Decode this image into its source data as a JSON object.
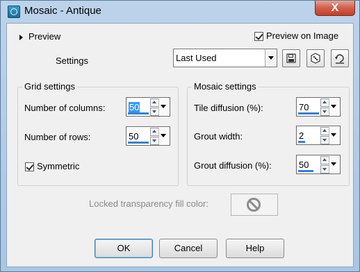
{
  "window": {
    "title": "Mosaic - Antique",
    "close_label": "X"
  },
  "preview": {
    "label": "Preview",
    "preview_on_image_label": "Preview on Image",
    "preview_on_image_checked": true
  },
  "settings": {
    "label": "Settings",
    "preset_value": "Last Used"
  },
  "grid_settings": {
    "title": "Grid settings",
    "columns_label": "Number of columns:",
    "columns_value": "50",
    "rows_label": "Number of rows:",
    "rows_value": "50",
    "symmetric_label": "Symmetric",
    "symmetric_checked": true
  },
  "mosaic_settings": {
    "title": "Mosaic settings",
    "tile_diffusion_label": "Tile diffusion (%):",
    "tile_diffusion_value": "70",
    "grout_width_label": "Grout width:",
    "grout_width_value": "2",
    "grout_diffusion_label": "Grout diffusion (%):",
    "grout_diffusion_value": "50"
  },
  "locked_fill": {
    "label": "Locked transparency fill color:"
  },
  "buttons": {
    "ok": "OK",
    "cancel": "Cancel",
    "help": "Help"
  },
  "icons": [
    "app-icon",
    "save-icon",
    "randomize-icon",
    "reset-icon",
    "no-color-icon"
  ]
}
